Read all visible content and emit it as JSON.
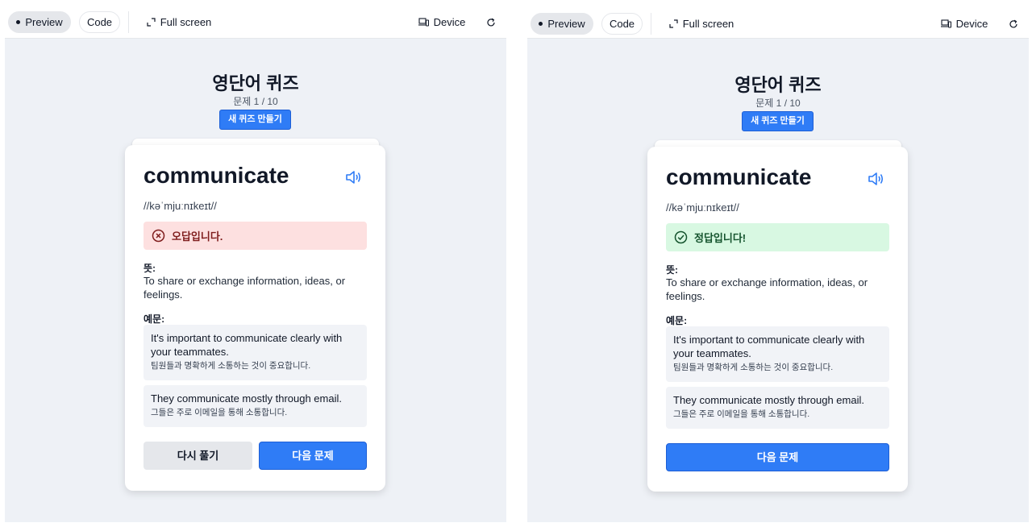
{
  "colors": {
    "accent": "#2f7cf6",
    "wrong_bg": "#fde0e0",
    "wrong_text": "#7f1d1d",
    "correct_bg": "#d8f8e2",
    "correct_text": "#14532d",
    "canvas_bg": "#eef1f6"
  },
  "toolbar": {
    "preview_label": "Preview",
    "code_label": "Code",
    "fullscreen_label": "Full screen",
    "device_label": "Device",
    "icons": [
      "expand-icon",
      "device-icon",
      "refresh-icon"
    ]
  },
  "quiz": {
    "title": "영단어 퀴즈",
    "progress": "문제 1 / 10",
    "new_quiz_label": "새 퀴즈 만들기"
  },
  "card": {
    "word": "communicate",
    "pronunciation": "//kəˈmjuːnɪkeɪt//",
    "meaning_label": "뜻:",
    "meaning": "To share or exchange information, ideas, or feelings.",
    "examples_label": "예문:",
    "examples": [
      {
        "en": "It's important to communicate clearly with your teammates.",
        "ko": "팀원들과 명확하게 소통하는 것이 중요합니다."
      },
      {
        "en": "They communicate mostly through email.",
        "ko": "그들은 주로 이메일을 통해 소통합니다."
      }
    ]
  },
  "panels": {
    "left": {
      "result_text": "오답입니다.",
      "result_state": "wrong",
      "retry_label": "다시 풀기",
      "next_label": "다음 문제"
    },
    "right": {
      "result_text": "정답입니다!",
      "result_state": "correct",
      "next_label": "다음 문제"
    }
  }
}
